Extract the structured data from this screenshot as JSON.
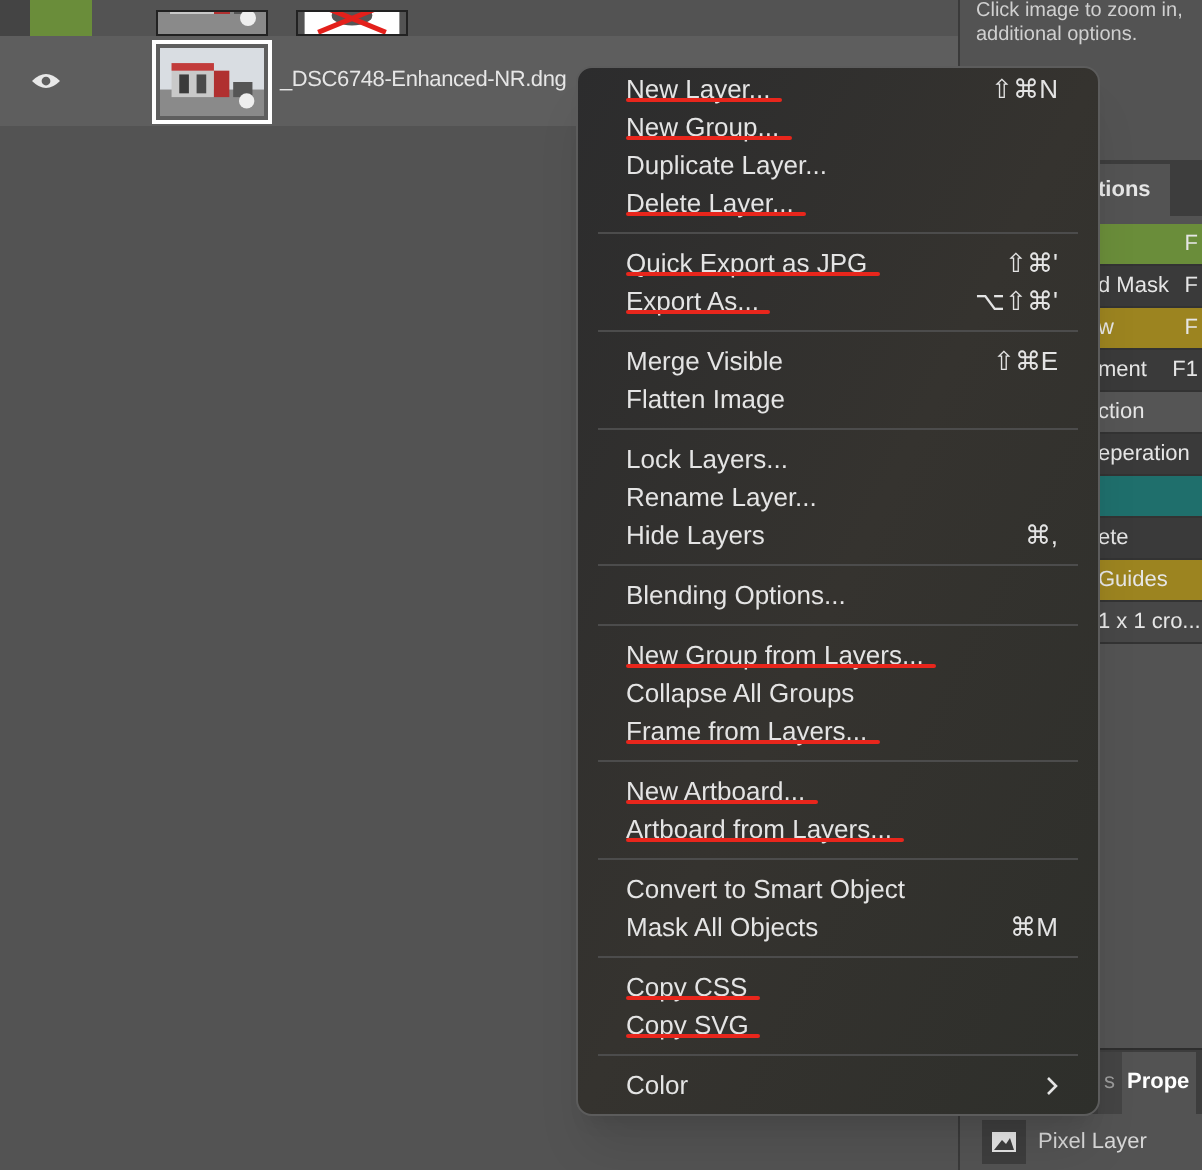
{
  "layers": {
    "top_row": {
      "color": "#6a8d3a"
    },
    "rows": [
      {
        "name": "_DSC6748-Enhanced-NR.dng",
        "visible": true,
        "selected": true
      }
    ]
  },
  "info_text": [
    "Click image to zoom in,",
    "additional options."
  ],
  "actions_panel": {
    "tab": "tions",
    "rows": [
      {
        "label": "",
        "shortcut": "F",
        "color": "#6a8d3a"
      },
      {
        "label": "d Mask",
        "shortcut": "F",
        "color": "#3a3a3a"
      },
      {
        "label": "w",
        "shortcut": "F",
        "color": "#9c8420"
      },
      {
        "label": "ment",
        "shortcut": "F1",
        "color": "#3a3a3a"
      },
      {
        "label": "ction",
        "shortcut": "",
        "color": "#555555"
      },
      {
        "label": "eperation",
        "shortcut": "",
        "color": "#3a3a3a"
      },
      {
        "label": "",
        "shortcut": "",
        "color": "#1f6f6c"
      },
      {
        "label": "ete",
        "shortcut": "",
        "color": "#3a3a3a"
      },
      {
        "label": "Guides",
        "shortcut": "",
        "color": "#9c8420"
      },
      {
        "label": "1 x 1 cro...",
        "shortcut": "",
        "color": "#474747"
      }
    ]
  },
  "bottom_tabs": [
    {
      "label": "s",
      "selected": false
    },
    {
      "label": "Prope",
      "selected": true
    }
  ],
  "properties": {
    "label": "Pixel Layer"
  },
  "menu": {
    "groups": [
      {
        "items": [
          {
            "label": "New Layer...",
            "shortcut": "⇧⌘N",
            "scribbled": true
          },
          {
            "label": "New Group...",
            "scribbled": true
          },
          {
            "label": "Duplicate Layer...",
            "scribbled": false
          },
          {
            "label": "Delete Layer...",
            "scribbled": true
          }
        ]
      },
      {
        "items": [
          {
            "label": "Quick Export as JPG",
            "shortcut": "⇧⌘'",
            "scribbled": true
          },
          {
            "label": "Export As...",
            "shortcut": "⌥⇧⌘'",
            "scribbled": true
          }
        ]
      },
      {
        "items": [
          {
            "label": "Merge Visible",
            "shortcut": "⇧⌘E",
            "scribbled": false
          },
          {
            "label": "Flatten Image",
            "scribbled": false
          }
        ]
      },
      {
        "items": [
          {
            "label": "Lock Layers...",
            "scribbled": false
          },
          {
            "label": "Rename Layer...",
            "scribbled": false
          },
          {
            "label": "Hide Layers",
            "shortcut": "⌘,",
            "scribbled": false
          }
        ]
      },
      {
        "items": [
          {
            "label": "Blending Options...",
            "scribbled": false
          }
        ]
      },
      {
        "items": [
          {
            "label": "New Group from Layers...",
            "scribbled": true
          },
          {
            "label": "Collapse All Groups",
            "scribbled": false
          },
          {
            "label": "Frame from Layers...",
            "scribbled": true
          }
        ]
      },
      {
        "items": [
          {
            "label": "New Artboard...",
            "scribbled": true
          },
          {
            "label": "Artboard from Layers...",
            "scribbled": true
          }
        ]
      },
      {
        "items": [
          {
            "label": "Convert to Smart Object",
            "scribbled": false
          },
          {
            "label": "Mask All Objects",
            "shortcut": "⌘M",
            "scribbled": false
          }
        ]
      },
      {
        "items": [
          {
            "label": "Copy CSS",
            "scribbled": true
          },
          {
            "label": "Copy SVG",
            "scribbled": true
          }
        ]
      },
      {
        "items": [
          {
            "label": "Color",
            "submenu": true,
            "scribbled": false
          }
        ]
      }
    ]
  }
}
